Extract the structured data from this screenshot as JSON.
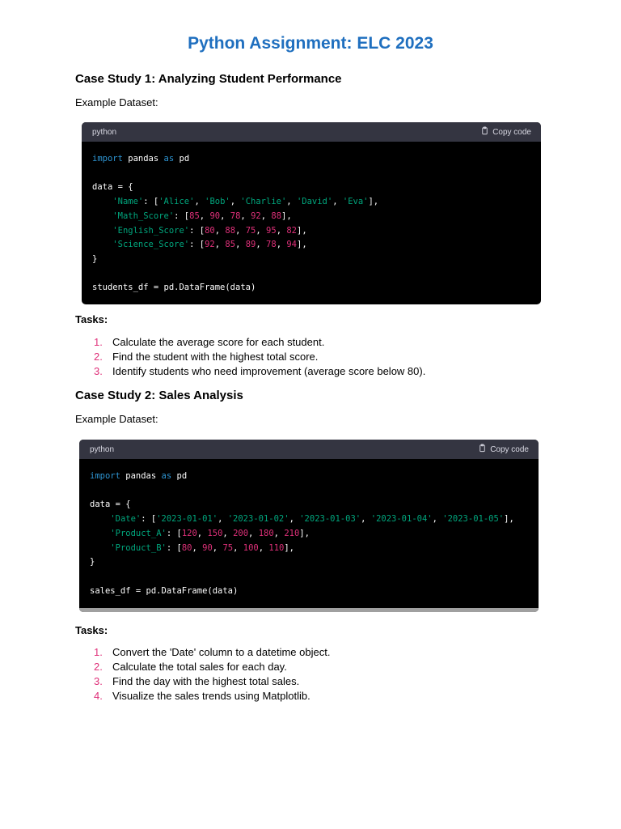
{
  "title": "Python Assignment: ELC 2023",
  "case1": {
    "heading": "Case Study 1: Analyzing Student Performance",
    "dataset_label": "Example Dataset:",
    "code_lang": "python",
    "copy_label": "Copy code",
    "code_lines": [
      [
        [
          "kw",
          "import"
        ],
        [
          "t",
          " pandas "
        ],
        [
          "kw",
          "as"
        ],
        [
          "t",
          " pd"
        ]
      ],
      [],
      [
        [
          "t",
          "data = {"
        ]
      ],
      [
        [
          "t",
          "    "
        ],
        [
          "str",
          "'Name'"
        ],
        [
          "t",
          ": ["
        ],
        [
          "str",
          "'Alice'"
        ],
        [
          "t",
          ", "
        ],
        [
          "str",
          "'Bob'"
        ],
        [
          "t",
          ", "
        ],
        [
          "str",
          "'Charlie'"
        ],
        [
          "t",
          ", "
        ],
        [
          "str",
          "'David'"
        ],
        [
          "t",
          ", "
        ],
        [
          "str",
          "'Eva'"
        ],
        [
          "t",
          "],"
        ]
      ],
      [
        [
          "t",
          "    "
        ],
        [
          "str",
          "'Math_Score'"
        ],
        [
          "t",
          ": ["
        ],
        [
          "num",
          "85"
        ],
        [
          "t",
          ", "
        ],
        [
          "num",
          "90"
        ],
        [
          "t",
          ", "
        ],
        [
          "num",
          "78"
        ],
        [
          "t",
          ", "
        ],
        [
          "num",
          "92"
        ],
        [
          "t",
          ", "
        ],
        [
          "num",
          "88"
        ],
        [
          "t",
          "],"
        ]
      ],
      [
        [
          "t",
          "    "
        ],
        [
          "str",
          "'English_Score'"
        ],
        [
          "t",
          ": ["
        ],
        [
          "num",
          "80"
        ],
        [
          "t",
          ", "
        ],
        [
          "num",
          "88"
        ],
        [
          "t",
          ", "
        ],
        [
          "num",
          "75"
        ],
        [
          "t",
          ", "
        ],
        [
          "num",
          "95"
        ],
        [
          "t",
          ", "
        ],
        [
          "num",
          "82"
        ],
        [
          "t",
          "],"
        ]
      ],
      [
        [
          "t",
          "    "
        ],
        [
          "str",
          "'Science_Score'"
        ],
        [
          "t",
          ": ["
        ],
        [
          "num",
          "92"
        ],
        [
          "t",
          ", "
        ],
        [
          "num",
          "85"
        ],
        [
          "t",
          ", "
        ],
        [
          "num",
          "89"
        ],
        [
          "t",
          ", "
        ],
        [
          "num",
          "78"
        ],
        [
          "t",
          ", "
        ],
        [
          "num",
          "94"
        ],
        [
          "t",
          "],"
        ]
      ],
      [
        [
          "t",
          "}"
        ]
      ],
      [],
      [
        [
          "t",
          "students_df = pd.DataFrame(data)"
        ]
      ]
    ],
    "tasks_label": "Tasks:",
    "tasks": [
      {
        "n": "1.",
        "text": "Calculate the average score for each student."
      },
      {
        "n": "2.",
        "text": "Find the student with the highest total score."
      },
      {
        "n": "3.",
        "text": "Identify students who need improvement (average score below 80)."
      }
    ]
  },
  "case2": {
    "heading": "Case Study 2: Sales Analysis",
    "dataset_label": "Example Dataset:",
    "code_lang": "python",
    "copy_label": "Copy code",
    "code_lines": [
      [
        [
          "kw",
          "import"
        ],
        [
          "t",
          " pandas "
        ],
        [
          "kw",
          "as"
        ],
        [
          "t",
          " pd"
        ]
      ],
      [],
      [
        [
          "t",
          "data = {"
        ]
      ],
      [
        [
          "t",
          "    "
        ],
        [
          "str",
          "'Date'"
        ],
        [
          "t",
          ": ["
        ],
        [
          "str",
          "'2023-01-01'"
        ],
        [
          "t",
          ", "
        ],
        [
          "str",
          "'2023-01-02'"
        ],
        [
          "t",
          ", "
        ],
        [
          "str",
          "'2023-01-03'"
        ],
        [
          "t",
          ", "
        ],
        [
          "str",
          "'2023-01-04'"
        ],
        [
          "t",
          ", "
        ],
        [
          "str",
          "'2023-01-05'"
        ],
        [
          "t",
          "],"
        ]
      ],
      [
        [
          "t",
          "    "
        ],
        [
          "str",
          "'Product_A'"
        ],
        [
          "t",
          ": ["
        ],
        [
          "num",
          "120"
        ],
        [
          "t",
          ", "
        ],
        [
          "num",
          "150"
        ],
        [
          "t",
          ", "
        ],
        [
          "num",
          "200"
        ],
        [
          "t",
          ", "
        ],
        [
          "num",
          "180"
        ],
        [
          "t",
          ", "
        ],
        [
          "num",
          "210"
        ],
        [
          "t",
          "],"
        ]
      ],
      [
        [
          "t",
          "    "
        ],
        [
          "str",
          "'Product_B'"
        ],
        [
          "t",
          ": ["
        ],
        [
          "num",
          "80"
        ],
        [
          "t",
          ", "
        ],
        [
          "num",
          "90"
        ],
        [
          "t",
          ", "
        ],
        [
          "num",
          "75"
        ],
        [
          "t",
          ", "
        ],
        [
          "num",
          "100"
        ],
        [
          "t",
          ", "
        ],
        [
          "num",
          "110"
        ],
        [
          "t",
          "],"
        ]
      ],
      [
        [
          "t",
          "}"
        ]
      ],
      [],
      [
        [
          "t",
          "sales_df = pd.DataFrame(data)"
        ]
      ]
    ],
    "tasks_label": "Tasks:",
    "tasks": [
      {
        "n": "1.",
        "text": "Convert the 'Date' column to a datetime object."
      },
      {
        "n": "2.",
        "text": "Calculate the total sales for each day."
      },
      {
        "n": "3.",
        "text": "Find the day with the highest total sales."
      },
      {
        "n": "4.",
        "text": "Visualize the sales trends using Matplotlib."
      }
    ]
  },
  "icons": {
    "copy": "clipboard-icon"
  },
  "colors": {
    "title": "#1f6fbf",
    "code_bg": "#000000",
    "code_header": "#343541",
    "keyword": "#2e95d3",
    "string": "#00a67d",
    "number": "#df3079"
  }
}
